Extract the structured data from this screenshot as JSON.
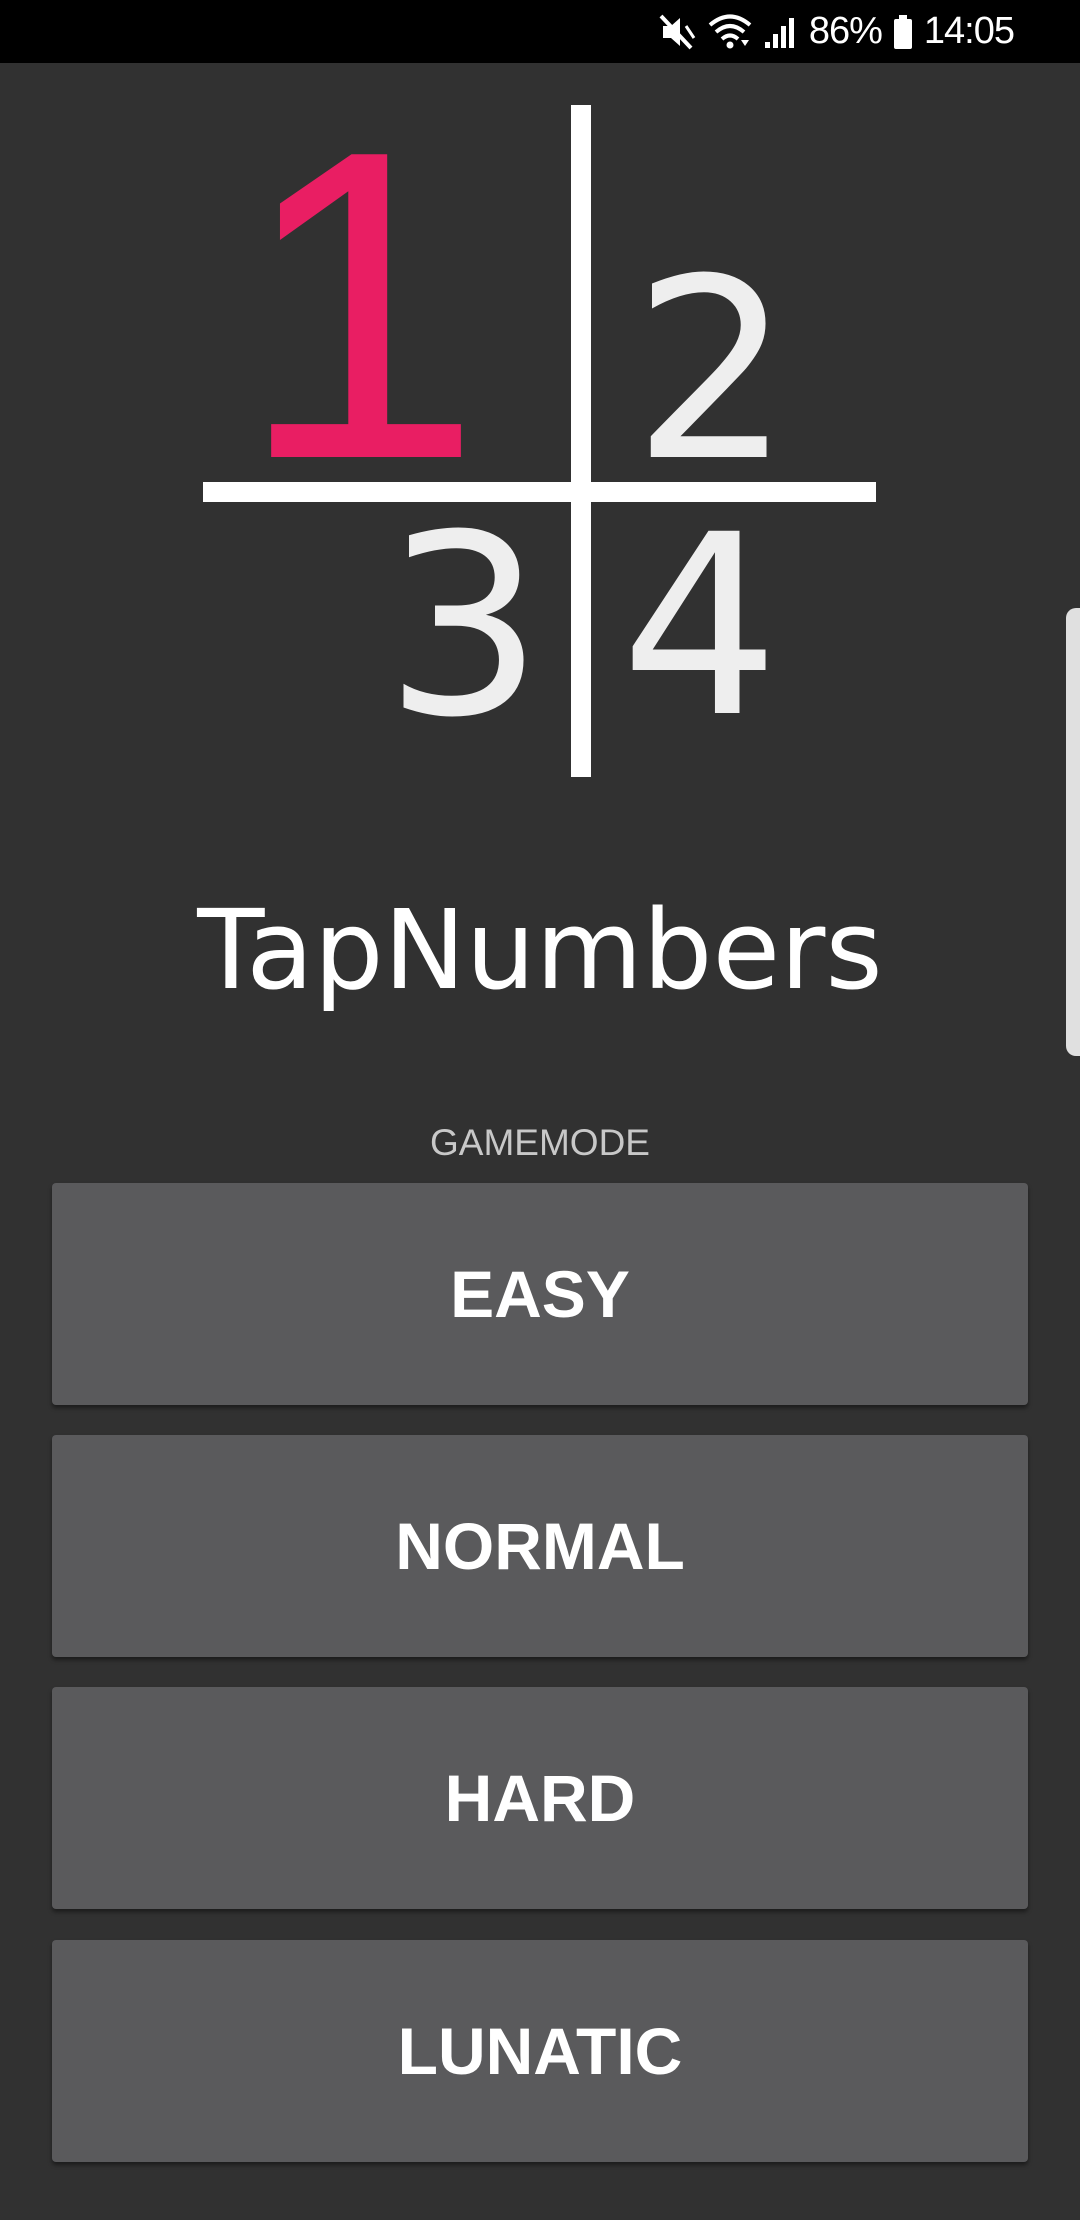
{
  "status_bar": {
    "battery_percent": "86%",
    "time": "14:05",
    "icons": [
      "mute-vibrate-icon",
      "wifi-icon",
      "cellular-signal-icon",
      "battery-icon"
    ]
  },
  "logo": {
    "digits": [
      "1",
      "2",
      "3",
      "4"
    ],
    "accent_color": "#e91e63",
    "digit_color": "#eeeeee"
  },
  "app": {
    "title": "TapNumbers",
    "gamemode_label": "GAMEMODE"
  },
  "modes": [
    {
      "label": "EASY"
    },
    {
      "label": "NORMAL"
    },
    {
      "label": "HARD"
    },
    {
      "label": "LUNATIC"
    }
  ],
  "colors": {
    "background": "#313131",
    "button": "#5a5a5c",
    "status_bar": "#000000"
  }
}
